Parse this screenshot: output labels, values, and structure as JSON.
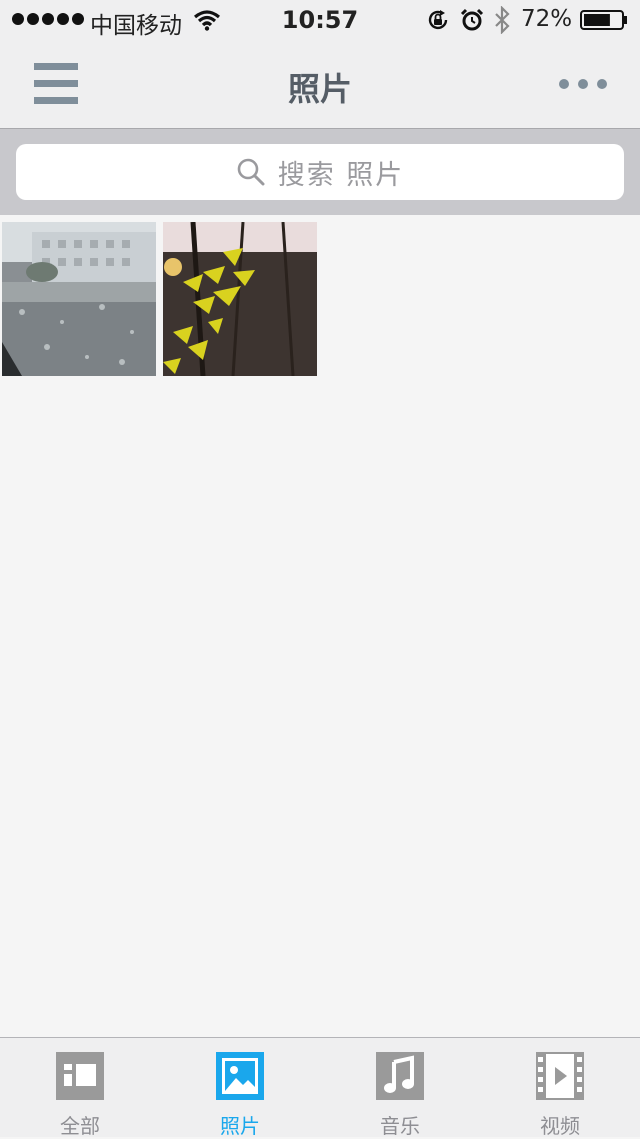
{
  "status_bar": {
    "carrier": "中国移动",
    "time": "10:57",
    "battery_percent": "72%",
    "battery_level": 0.72,
    "icons": [
      "wifi-icon",
      "rotation-lock-icon",
      "alarm-icon",
      "bluetooth-icon",
      "battery-icon"
    ]
  },
  "nav": {
    "title": "照片",
    "left_icon": "menu-icon",
    "right_icon": "more-icon"
  },
  "search": {
    "placeholder": "搜索 照片"
  },
  "photos": [
    {
      "icon": "photo-rainy-street"
    },
    {
      "icon": "photo-yellow-flowers"
    }
  ],
  "tabs": [
    {
      "label": "全部",
      "icon": "all-files-icon",
      "active": false
    },
    {
      "label": "照片",
      "icon": "photos-icon",
      "active": true
    },
    {
      "label": "音乐",
      "icon": "music-icon",
      "active": false
    },
    {
      "label": "视频",
      "icon": "video-icon",
      "active": false
    }
  ],
  "colors": {
    "accent": "#1aa7ec",
    "tab_inactive": "#8e8e93",
    "nav_icon": "#7f8e9a",
    "search_bar_bg": "#c8c8cc"
  }
}
